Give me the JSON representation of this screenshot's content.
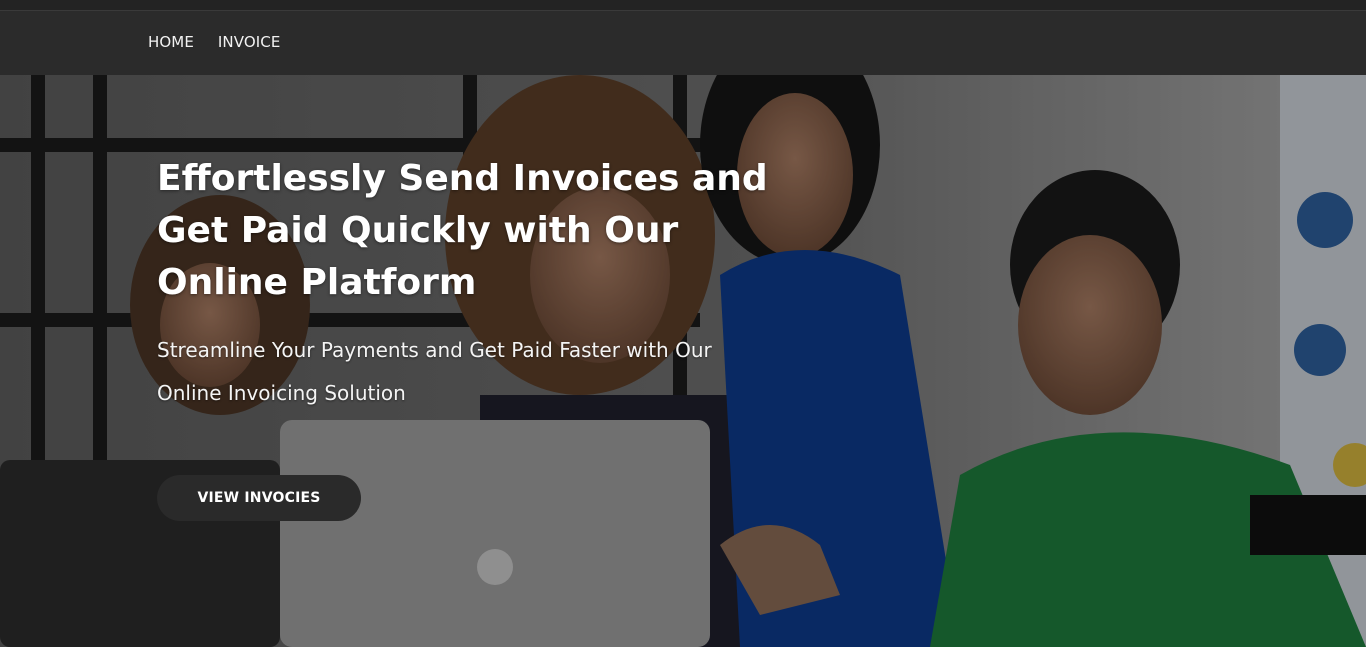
{
  "nav": {
    "items": [
      {
        "label": "HOME"
      },
      {
        "label": "INVOICE"
      }
    ]
  },
  "hero": {
    "title_lines": [
      "Effortlessly Send Invoices and",
      "Get Paid Quickly with Our",
      "Online Platform"
    ],
    "subtitle": "Streamline Your Payments and Get Paid Faster with Our Online Invoicing Solution",
    "cta_label": "VIEW INVOCIES"
  },
  "colors": {
    "navbar": "#2b2b2b",
    "button": "#2a2a2a",
    "shirt_green": "#1e7a3c",
    "shirt_blue": "#0d3a8a"
  }
}
